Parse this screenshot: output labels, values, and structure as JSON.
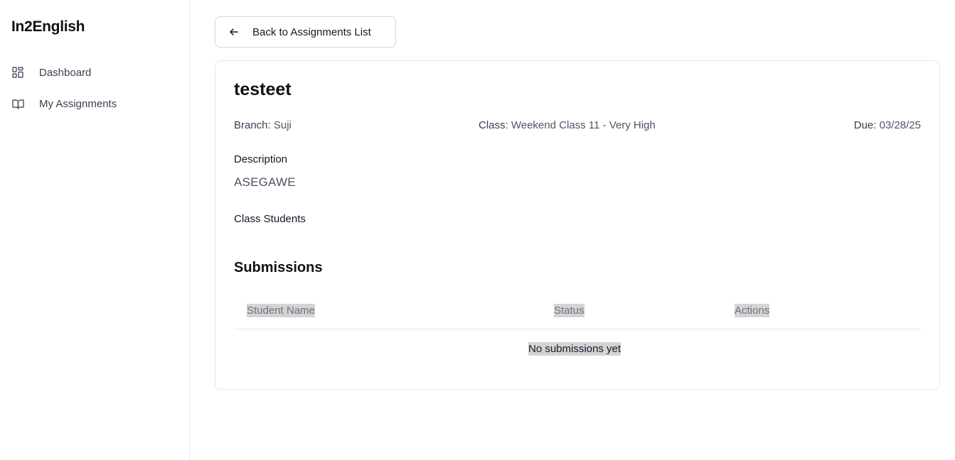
{
  "app": {
    "brand": "In2English"
  },
  "sidebar": {
    "items": [
      {
        "label": "Dashboard",
        "icon": "dashboard-grid-icon"
      },
      {
        "label": "My Assignments",
        "icon": "open-book-icon"
      }
    ]
  },
  "toolbar": {
    "back_label": "Back to Assignments List",
    "back_icon": "arrow-left-icon"
  },
  "assignment": {
    "title": "testeet",
    "branch_key": "Branch:",
    "branch_value": "Suji",
    "class_key": "Class:",
    "class_value": "Weekend Class 11 - Very High",
    "due_key": "Due:",
    "due_value": "03/28/25",
    "description_label": "Description",
    "description_value": "ASEGAWE",
    "students_label": "Class Students"
  },
  "submissions": {
    "title": "Submissions",
    "columns": [
      "Student Name",
      "Status",
      "Actions"
    ],
    "empty_text": "No submissions yet"
  },
  "colors": {
    "border": "#e5e7eb",
    "text": "#111827",
    "muted": "#6b7280",
    "highlight": "#d4d4d4"
  }
}
